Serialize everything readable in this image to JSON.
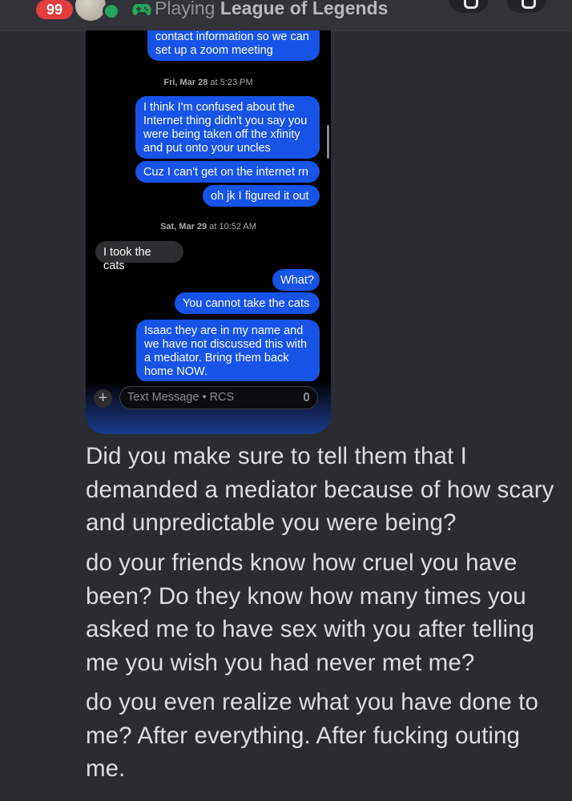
{
  "status_bar": {
    "notification_count": "99",
    "activity_prefix": "Playing",
    "activity_game": "League of Legends",
    "accent_color": "#e33c3f",
    "online_color": "#23a55a"
  },
  "screenshot": {
    "bubbles": [
      {
        "dir": "out",
        "text": "contact information so we can set up a zoom meeting"
      },
      {
        "dir": "out",
        "text": "I think I'm confused about the Internet thing didn't you say you were being taken off the xfinity and put onto your uncles"
      },
      {
        "dir": "out",
        "text": "Cuz I can't get on the internet rn"
      },
      {
        "dir": "out",
        "text": "oh jk I figured it out"
      },
      {
        "dir": "in",
        "text": "I took the cats"
      },
      {
        "dir": "out",
        "text": "What?"
      },
      {
        "dir": "out",
        "text": "You cannot take the cats"
      },
      {
        "dir": "out",
        "text": "Isaac they are in my name and we have not discussed this with a mediator. Bring them back home NOW."
      }
    ],
    "timestamps": {
      "t1_day": "Fri, Mar 28",
      "t1_at": " at ",
      "t1_time": "5:23 PM",
      "t2_day": "Sat, Mar 29",
      "t2_at": " at ",
      "t2_time": "10:52 AM"
    },
    "composer": {
      "plus": "+",
      "placeholder": "Text Message • RCS"
    }
  },
  "messages": [
    "Did you make sure to tell them that I demanded a mediator because of how scary and unpredictable you were being?",
    "do your friends know how cruel you have been? Do they know how many times you asked me to have sex with you after telling me you wish you had never met me?",
    "do you even realize what you have done to me? After everything. After fucking outing me."
  ]
}
